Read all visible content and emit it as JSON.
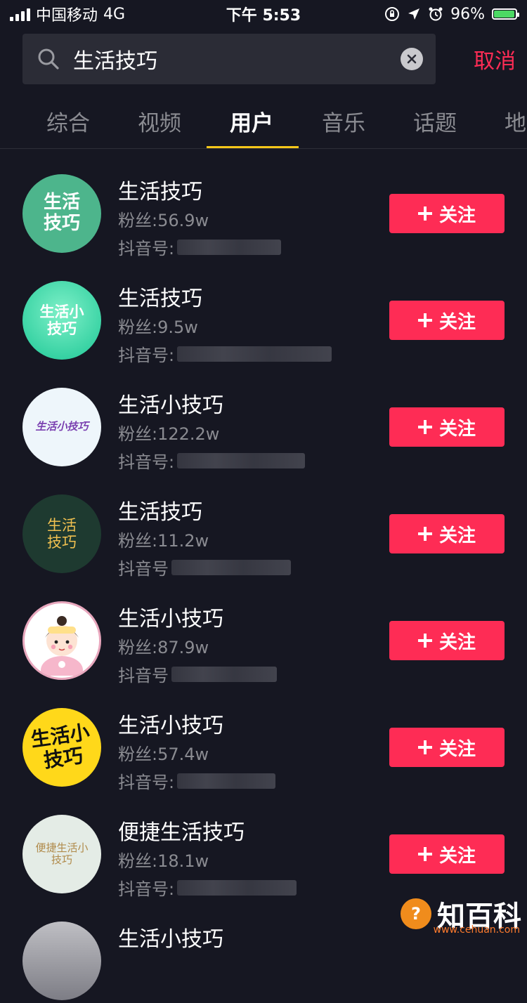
{
  "status_bar": {
    "carrier": "中国移动",
    "network": "4G",
    "time": "下午 5:53",
    "battery": "96%",
    "battery_level": 0.96
  },
  "search": {
    "query": "生活技巧",
    "cancel_label": "取消"
  },
  "tabs": [
    {
      "label": "综合",
      "active": false
    },
    {
      "label": "视频",
      "active": false
    },
    {
      "label": "用户",
      "active": true
    },
    {
      "label": "音乐",
      "active": false
    },
    {
      "label": "话题",
      "active": false
    },
    {
      "label": "地",
      "active": false
    }
  ],
  "users": [
    {
      "name": "生活技巧",
      "fans": "粉丝:56.9w",
      "douyin": "抖音号:",
      "avatar_text": "生活技巧",
      "avatar_bg": "#4db58c",
      "avatar_fg": "#ffffff",
      "follow_label": "关注"
    },
    {
      "name": "生活技巧",
      "fans": "粉丝:9.5w",
      "douyin": "抖音号:",
      "avatar_text": "生活小技巧",
      "avatar_bg": "#2fd6a0",
      "avatar_fg": "#ffffff",
      "follow_label": "关注"
    },
    {
      "name": "生活小技巧",
      "fans": "粉丝:122.2w",
      "douyin": "抖音号:",
      "avatar_text": "生活小技巧",
      "avatar_bg": "#eef6fb",
      "avatar_fg": "#7a3fb0",
      "follow_label": "关注"
    },
    {
      "name": "生活技巧",
      "fans": "粉丝:11.2w",
      "douyin": "抖音号",
      "avatar_text": "生活技巧",
      "avatar_bg": "#1e3a30",
      "avatar_fg": "#f0c050",
      "follow_label": "关注"
    },
    {
      "name": "生活小技巧",
      "fans": "粉丝:87.9w",
      "douyin": "抖音号",
      "avatar_text": "",
      "avatar_bg": "#fbe9ef",
      "avatar_fg": "#333333",
      "follow_label": "关注"
    },
    {
      "name": "生活小技巧",
      "fans": "粉丝:57.4w",
      "douyin": "抖音号:",
      "avatar_text": "生活小技巧",
      "avatar_bg": "#ffd81a",
      "avatar_fg": "#111111",
      "follow_label": "关注"
    },
    {
      "name": "便捷生活技巧",
      "fans": "粉丝:18.1w",
      "douyin": "抖音号:",
      "avatar_text": "便捷生活小技巧",
      "avatar_bg": "#e4ece6",
      "avatar_fg": "#b08a4a",
      "follow_label": "关注"
    },
    {
      "name": "生活小技巧",
      "fans": "",
      "douyin": "",
      "avatar_text": "",
      "avatar_bg": "#cfcfd4",
      "avatar_fg": "#333333",
      "follow_label": ""
    }
  ],
  "watermark": {
    "logo_glyph": "?",
    "text": "知百科",
    "url": "www.cehuan.com"
  }
}
